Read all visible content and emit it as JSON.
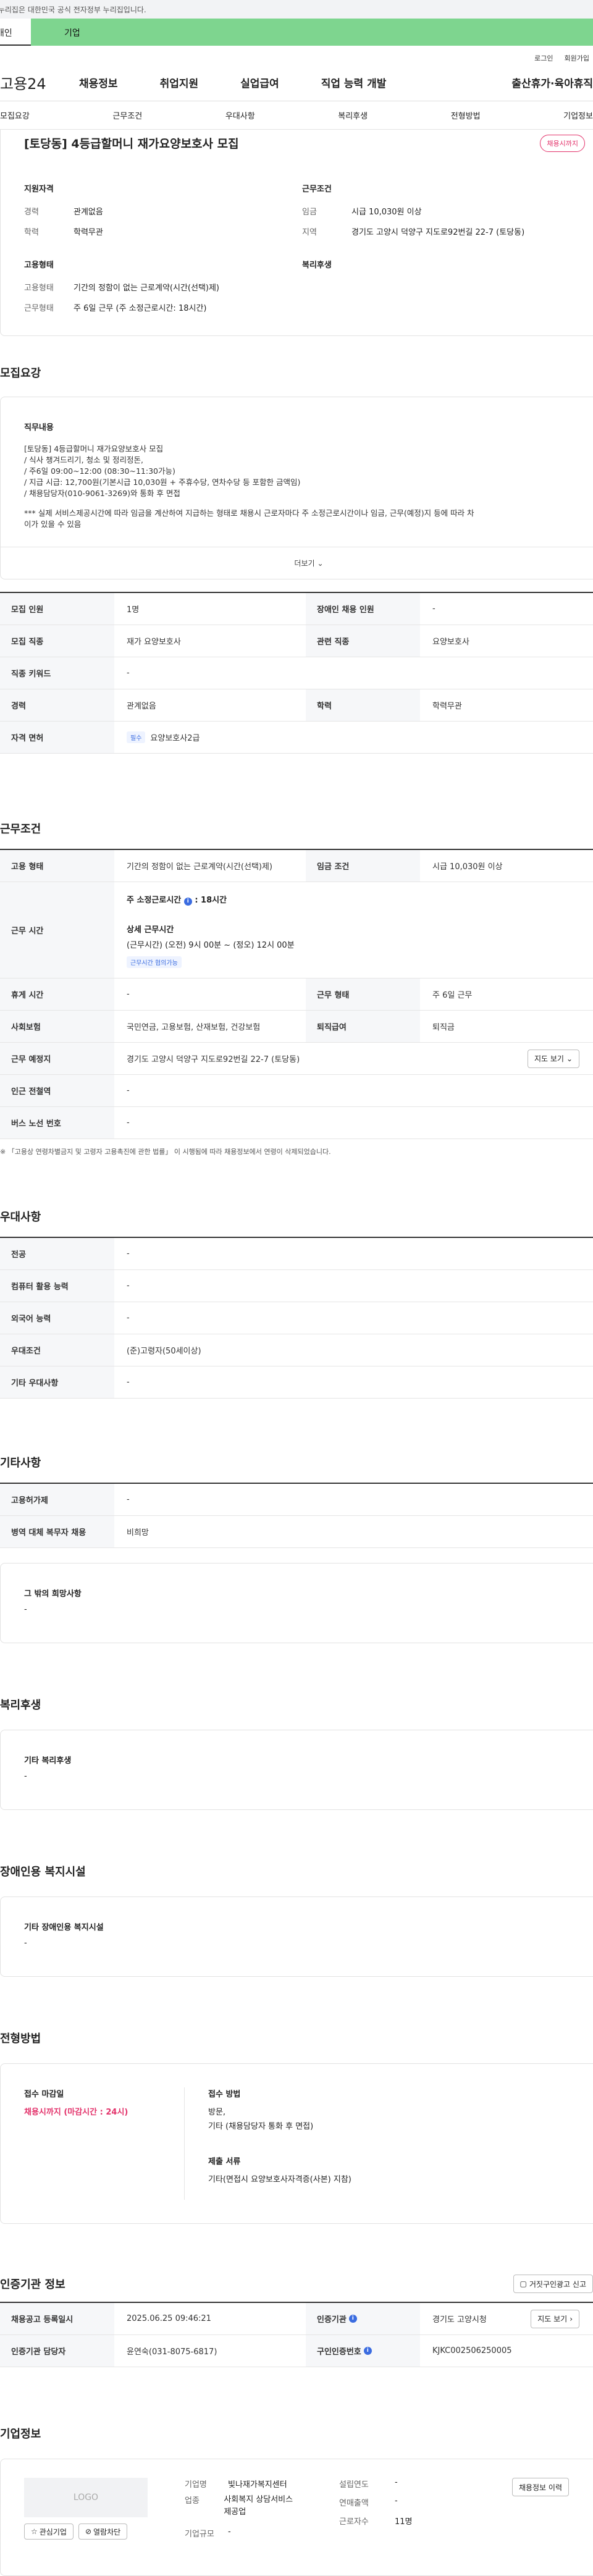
{
  "gov_banner": "이 누리집은 대한민국 공식 전자정부 누리집입니다.",
  "user_tabs": [
    "개인",
    "기업"
  ],
  "top_links": [
    "로그인",
    "회원가입"
  ],
  "logo": "고용24",
  "gnb": [
    "채용정보",
    "취업지원",
    "실업급여",
    "직업 능력 개발",
    "출산휴가·육아휴직"
  ],
  "subnav": [
    "모집요강",
    "근무조건",
    "우대사항",
    "복리후생",
    "전형방법",
    "기업정보"
  ],
  "job": {
    "title": "[토당동] 4등급할머니 재가요양보호사 모집",
    "badge": "채용시까지",
    "qual_h": "지원자격",
    "work_h": "근무조건",
    "emp_h": "고용형태",
    "welfare_h": "복리후생",
    "qual": [
      {
        "k": "경력",
        "v": "관계없음"
      },
      {
        "k": "학력",
        "v": "학력무관"
      }
    ],
    "work": [
      {
        "k": "임금",
        "v": "시급 10,030원 이상"
      },
      {
        "k": "지역",
        "v": "경기도 고양시 덕양구 지도로92번길 22-7 (토당동)"
      }
    ],
    "emp": [
      {
        "k": "고용형태",
        "v": "기간의 정함이 없는 근로계약(시간(선택)제)"
      },
      {
        "k": "근무형태",
        "v": "주 6일 근무 (주 소정근로시간: 18시간)"
      }
    ]
  },
  "recruit": {
    "h": "모집요강",
    "duty_h": "직무내용",
    "duty": [
      "[토당동] 4등급할머니 재가요양보호사 모집",
      "/ 식사 챙겨드리기, 청소 및 정리정돈,",
      "/ 주6일 09:00~12:00 (08:30~11:30가능)",
      "/ 지급 시급: 12,700원(기본시급 10,030원 + 주휴수당, 연차수당 등 포함한 금액임)",
      "/ 채용담당자(010-9061-3269)와 통화 후 면접",
      "",
      "*** 실제 서비스제공시간에 따라 임금을 계산하여 지급하는 형태로 채용시 근로자마다 주 소정근로시간이나 임금, 근무(예정)지 등에 따라 차",
      "이가 있을 수 있음"
    ],
    "more": "더보기",
    "rows": [
      [
        {
          "k": "모집 인원",
          "v": "1명"
        },
        {
          "k": "장애인 채용 인원",
          "v": "-"
        }
      ],
      [
        {
          "k": "모집 직종",
          "v": "재가 요양보호사"
        },
        {
          "k": "관련 직종",
          "v": "요양보호사"
        }
      ],
      [
        {
          "k": "직종 키워드",
          "v": "-"
        }
      ],
      [
        {
          "k": "경력",
          "v": "관계없음"
        },
        {
          "k": "학력",
          "v": "학력무관"
        }
      ]
    ],
    "license_k": "자격 면허",
    "license_tag": "필수",
    "license_v": "요양보호사2급"
  },
  "cond": {
    "h": "근무조건",
    "r1": [
      {
        "k": "고용 형태",
        "v": "기간의 정함이 없는 근로계약(시간(선택)제)"
      },
      {
        "k": "임금 조건",
        "v": "시급 10,030원 이상"
      }
    ],
    "time_k": "근무 시간",
    "hours_label": "주 소정근로시간",
    "hours_v": ": 18시간",
    "detail_h": "상세 근무시간",
    "detail_v": "(근무시간) (오전) 9시 00분 ~ (정오) 12시 00분",
    "detail_tag": "근무시간 협의가능",
    "r2": [
      {
        "k": "휴게 시간",
        "v": "-"
      },
      {
        "k": "근무 형태",
        "v": "주 6일 근무"
      }
    ],
    "r3": [
      {
        "k": "사회보험",
        "v": "국민연금, 고용보험, 산재보험, 건강보험"
      },
      {
        "k": "퇴직급여",
        "v": "퇴직금"
      }
    ],
    "place_k": "근무 예정지",
    "place_v": "경기도 고양시 덕양구 지도로92번길 22-7 (토당동)",
    "map_btn": "지도 보기",
    "subway_k": "인근 전철역",
    "subway_v": "-",
    "bus_k": "버스 노선 번호",
    "bus_v": "-",
    "note": "※ 「고용상 연령차별금지 및 고령자 고용촉진에 관한 법률」 이 시행됨에 따라 채용정보에서 연령이 삭제되었습니다."
  },
  "pref": {
    "h": "우대사항",
    "rows": [
      {
        "k": "전공",
        "v": "-"
      },
      {
        "k": "컴퓨터 활용 능력",
        "v": "-"
      },
      {
        "k": "외국어 능력",
        "v": "-"
      },
      {
        "k": "우대조건",
        "v": "(준)고령자(50세이상)"
      },
      {
        "k": "기타 우대사항",
        "v": "-"
      }
    ]
  },
  "etc": {
    "h": "기타사항",
    "rows": [
      {
        "k": "고용허가제",
        "v": "-"
      },
      {
        "k": "병역 대체 복무자 채용",
        "v": "비희망"
      }
    ],
    "box_h": "그 밖의 희망사항",
    "box_v": "-"
  },
  "welfare": {
    "h": "복리후생",
    "box_h": "기타 복리후생",
    "box_v": "-"
  },
  "disab": {
    "h": "장애인용 복지시설",
    "box_h": "기타 장애인용 복지시설",
    "box_v": "-"
  },
  "select": {
    "h": "전형방법",
    "deadline_h": "접수 마감일",
    "deadline_v": "채용시까지 (마감시간 : 24시)",
    "method_h": "접수 방법",
    "method_v1": "방문,",
    "method_v2": "기타 (채용담당자 통화 후 면접)",
    "docs_h": "제출 서류",
    "docs_v": "기타(면접시 요양보호사자격증(사본) 지참)"
  },
  "agency": {
    "h": "인증기관 정보",
    "report_btn": "거짓구인광고 신고",
    "r1": [
      {
        "k": "채용공고 등록일시",
        "v": "2025.06.25 09:46:21"
      },
      {
        "k": "인증기관",
        "v": "경기도 고양시청"
      }
    ],
    "map_btn": "지도 보기",
    "r2": [
      {
        "k": "인증기관 담당자",
        "v": "윤연숙(031-8075-6817)"
      },
      {
        "k": "구인인증번호",
        "v": "KJKC002506250005"
      }
    ]
  },
  "company": {
    "h": "기업정보",
    "logo": "LOGO",
    "fav_btn": "관심기업",
    "block_btn": "열람차단",
    "f1": [
      {
        "k": "기업명",
        "v": "빛나재가복지센터"
      },
      {
        "k": "업종",
        "v": "사회복지 상담서비스 제공업"
      },
      {
        "k": "기업규모",
        "v": "-"
      }
    ],
    "f2": [
      {
        "k": "설립연도",
        "v": "-"
      },
      {
        "k": "연매출액",
        "v": "-"
      },
      {
        "k": "근로자수",
        "v": "11명"
      }
    ],
    "history_btn": "채용정보 이력"
  }
}
